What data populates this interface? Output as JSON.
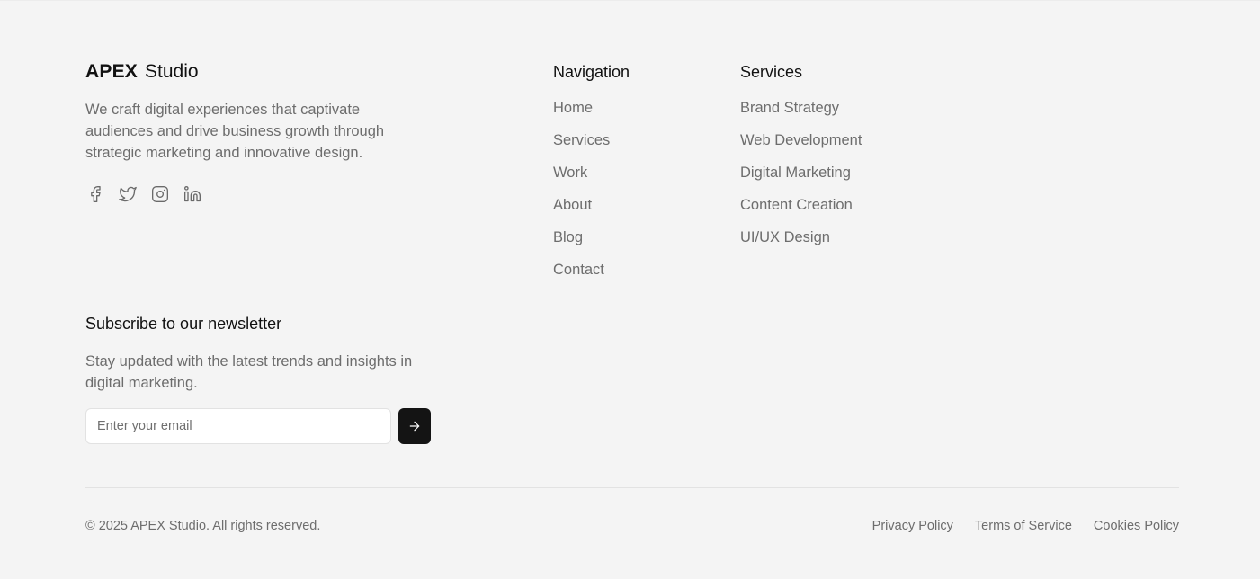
{
  "brand": {
    "name_bold": "APEX",
    "name_light": "Studio"
  },
  "about": {
    "tagline": "We craft digital experiences that captivate audiences and drive business growth through strategic marketing and innovative design."
  },
  "social": [
    {
      "icon": "facebook-icon"
    },
    {
      "icon": "twitter-icon"
    },
    {
      "icon": "instagram-icon"
    },
    {
      "icon": "linkedin-icon"
    }
  ],
  "navigation": {
    "title": "Navigation",
    "links": [
      "Home",
      "Services",
      "Work",
      "About",
      "Blog",
      "Contact"
    ]
  },
  "services": {
    "title": "Services",
    "links": [
      "Brand Strategy",
      "Web Development",
      "Digital Marketing",
      "Content Creation",
      "UI/UX Design"
    ]
  },
  "newsletter": {
    "title": "Subscribe to our newsletter",
    "description": "Stay updated with the latest trends and insights in digital marketing.",
    "email_placeholder": "Enter your email",
    "email_value": "",
    "submit_icon": "arrow-right-icon"
  },
  "bottom": {
    "copyright": "© 2025 APEX Studio. All rights reserved.",
    "legal_links": [
      "Privacy Policy",
      "Terms of Service",
      "Cookies Policy"
    ]
  },
  "colors": {
    "background": "#f4f4f4",
    "heading": "#111111",
    "muted_text": "#6d6d6d",
    "button_bg": "#141414",
    "divider": "#e2e2e2"
  }
}
